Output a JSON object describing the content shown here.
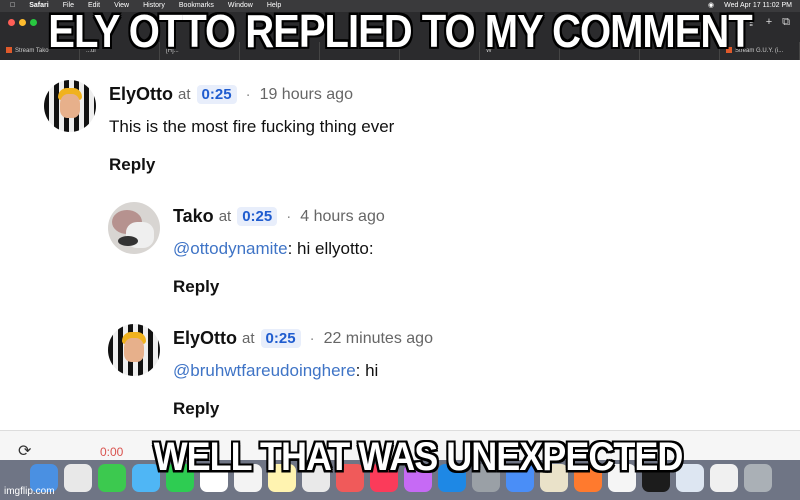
{
  "menubar": {
    "apple": "",
    "app": "Safari",
    "items": [
      "File",
      "Edit",
      "View",
      "History",
      "Bookmarks",
      "Window",
      "Help"
    ],
    "clock": "Wed Apr 17  11:02 PM"
  },
  "tabs": [
    {
      "label": "Stream Tako"
    },
    {
      "label": "...ui"
    },
    {
      "label": "[H]..."
    },
    {
      "label": ""
    },
    {
      "label": ""
    },
    {
      "label": ""
    },
    {
      "label": "W"
    },
    {
      "label": ""
    },
    {
      "label": ""
    },
    {
      "label": "Stream G.U.Y. (i..."
    }
  ],
  "comments": [
    {
      "name": "ElyOtto",
      "at": "at",
      "timestamp": "0:25",
      "dot": "·",
      "ago": "19 hours ago",
      "body": "This is the most fire fucking thing ever",
      "reply": "Reply"
    },
    {
      "name": "Tako",
      "at": "at",
      "timestamp": "0:25",
      "dot": "·",
      "ago": "4 hours ago",
      "mention": "@ottodynamite",
      "body_rest": ": hi ellyotto:",
      "reply": "Reply"
    },
    {
      "name": "ElyOtto",
      "at": "at",
      "timestamp": "0:25",
      "dot": "·",
      "ago": "22 minutes ago",
      "mention": "@bruhwtfareudoinghere",
      "body_rest": ": hi",
      "reply": "Reply"
    }
  ],
  "player": {
    "time": "0:00"
  },
  "captions": {
    "top": "ELY OTTO REPLIED TO MY COMMENT",
    "bottom": "WELL THAT WAS UNEXPECTED"
  },
  "watermark": "imgflip.com",
  "colors": {
    "accent_link": "#3f74c6",
    "timestamp_chip": "#1f5ccf"
  }
}
